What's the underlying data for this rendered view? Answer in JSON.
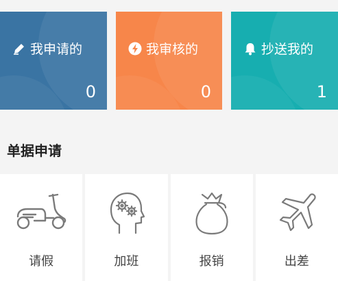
{
  "cards": [
    {
      "label": "我申请的",
      "count": "0",
      "icon": "pencil-icon",
      "color": "#3a74a3"
    },
    {
      "label": "我审核的",
      "count": "0",
      "icon": "lightning-icon",
      "color": "#f7864a"
    },
    {
      "label": "抄送我的",
      "count": "1",
      "icon": "bell-icon",
      "color": "#17aeb0"
    }
  ],
  "section": {
    "title": "单据申请"
  },
  "forms": [
    {
      "label": "请假",
      "icon": "scooter-icon"
    },
    {
      "label": "加班",
      "icon": "head-gears-icon"
    },
    {
      "label": "报销",
      "icon": "money-bag-icon"
    },
    {
      "label": "出差",
      "icon": "airplane-icon"
    }
  ]
}
